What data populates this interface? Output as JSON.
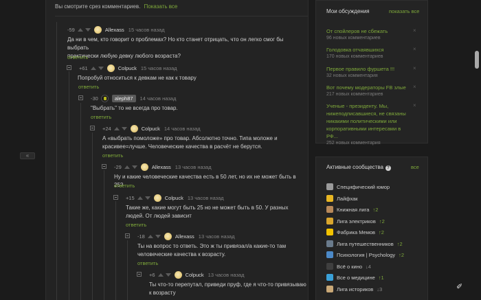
{
  "slice_note": {
    "text": "Вы смотрите срез комментариев.",
    "link": "Показать все"
  },
  "gutter": {
    "label": "«"
  },
  "comments": [
    {
      "score": "-59",
      "nick": "Allexass",
      "time": "15 часов назад",
      "text": [
        "Да ни в чем, кто говорит о проблемах? Но кто станет отрицать, что он легко смог бы выбрать",
        "практически любую девку любого возраста?"
      ],
      "reply": "ответить"
    },
    {
      "score": "+61",
      "nick": "Colpuck",
      "time": "15 часов назад",
      "text": [
        "Попробуй относиться к девкам не как к товару"
      ],
      "reply": "ответить"
    },
    {
      "score": "-30",
      "nick": "aleph87",
      "time": "14 часов назад",
      "text": [
        "\"Выбрать\" то не всегда про товар."
      ],
      "reply": "ответить"
    },
    {
      "score": "+24",
      "nick": "Colpuck",
      "time": "14 часов назад",
      "text": [
        "А «выбрать помоложе» про товар. Абсолютно точно. Типа моложе и",
        "красивее=лучше. Человеческие качества в расчёт не берутся."
      ],
      "reply": "ответить"
    },
    {
      "score": "-29",
      "nick": "Allexass",
      "time": "13 часов назад",
      "text": [
        "Ну и какие человеческие качества есть в 50 лет, но их не может быть в 25?"
      ],
      "reply": "ответить"
    },
    {
      "score": "+15",
      "nick": "Colpuck",
      "time": "13 часов назад",
      "text": [
        "Такие же, какие могут быть 25 но не может быть в 50. У разных",
        "людей. От людей зависит"
      ],
      "reply": "ответить"
    },
    {
      "score": "-18",
      "nick": "Allexass",
      "time": "13 часов назад",
      "text": [
        "Ты на вопрос то ответь. Это ж ты привязал/а какие-то там",
        "человеческие качества к возрасту."
      ],
      "reply": "ответить"
    },
    {
      "score": "+6",
      "nick": "Colpuck",
      "time": "13 часов назад",
      "text": [
        "Ты что-то перепутал, приведи пруф, где я что-то привязываю",
        "к возрасту"
      ],
      "reply": ""
    }
  ],
  "discussions": {
    "title": "Мои обсуждения",
    "show_all": "показать все",
    "items": [
      {
        "title": [
          "От спойлеров не сбежать"
        ],
        "count": "96 новых комментариев"
      },
      {
        "title": [
          "Голодовка отчаявшихся"
        ],
        "count": "170 новых комментариев"
      },
      {
        "title": [
          "Первое правило фуршета !!!"
        ],
        "count": "32 новых комментария"
      },
      {
        "title": [
          "Вот почему модераторы FB злые"
        ],
        "count": "217 новых комментариев"
      },
      {
        "title": [
          "Ученые - президенту. Мы,",
          "нижеподписавшиеся, не связаны",
          "никакими политическими или",
          "корпоративными интересами в РФ..."
        ],
        "count": "252 новых комментария"
      }
    ]
  },
  "communities": {
    "title": "Активные сообщества",
    "all": "все",
    "items": [
      {
        "name": "Специфический юмор",
        "trend": "",
        "dir": "",
        "color": "#9a9a9a"
      },
      {
        "name": "Лайфхак",
        "trend": "",
        "dir": "",
        "color": "#e8b623"
      },
      {
        "name": "Книжная лига",
        "trend": "↑2",
        "dir": "up",
        "color": "#b8895a"
      },
      {
        "name": "Лига электриков",
        "trend": "↑2",
        "dir": "up",
        "color": "#d9a62e"
      },
      {
        "name": "Фабрика Мемов",
        "trend": "↑2",
        "dir": "up",
        "color": "#f2c200"
      },
      {
        "name": "Лига путешественников",
        "trend": "↑2",
        "dir": "up",
        "color": "#6a7b8c"
      },
      {
        "name": "Психология | Psychology",
        "trend": "↑2",
        "dir": "up",
        "color": "#4c89c7"
      },
      {
        "name": "Всё о кино",
        "trend": "↓4",
        "dir": "down",
        "color": "#3f3f3f"
      },
      {
        "name": "Все о медицине",
        "trend": "↑1",
        "dir": "up",
        "color": "#3aa0d8"
      },
      {
        "name": "Лига историков",
        "trend": "↓3",
        "dir": "down",
        "color": "#c9a877"
      }
    ]
  }
}
